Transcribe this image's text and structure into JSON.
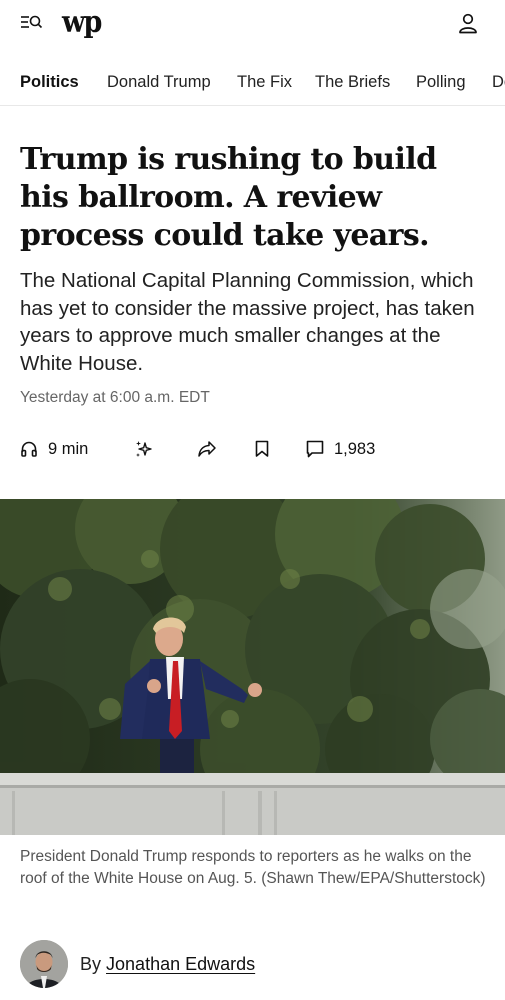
{
  "header": {
    "logo_text": "wp",
    "menu_icon": "menu-search-icon",
    "account_icon": "account-icon"
  },
  "nav": {
    "items": [
      {
        "label": "Politics",
        "active": true
      },
      {
        "label": "Donald Trump",
        "active": false
      },
      {
        "label": "The Fix",
        "active": false
      },
      {
        "label": "The Briefs",
        "active": false
      },
      {
        "label": "Polling",
        "active": false
      },
      {
        "label": "Democracy",
        "active": false
      }
    ]
  },
  "article": {
    "headline": "Trump is rushing to build his ballroom. A review process could take years.",
    "dek": "The National Capital Planning Commission, which has yet to consider the massive project, has taken years to approve much smaller changes at the White House.",
    "timestamp": "Yesterday at 6:00 a.m. EDT",
    "listen_label": "9 min",
    "comments_count": "1,983",
    "caption": "President Donald Trump responds to reporters as he walks on the roof of the White House on Aug. 5. (Shawn Thew/EPA/Shutterstock)",
    "byline_prefix": "By",
    "author": "Jonathan Edwards"
  }
}
